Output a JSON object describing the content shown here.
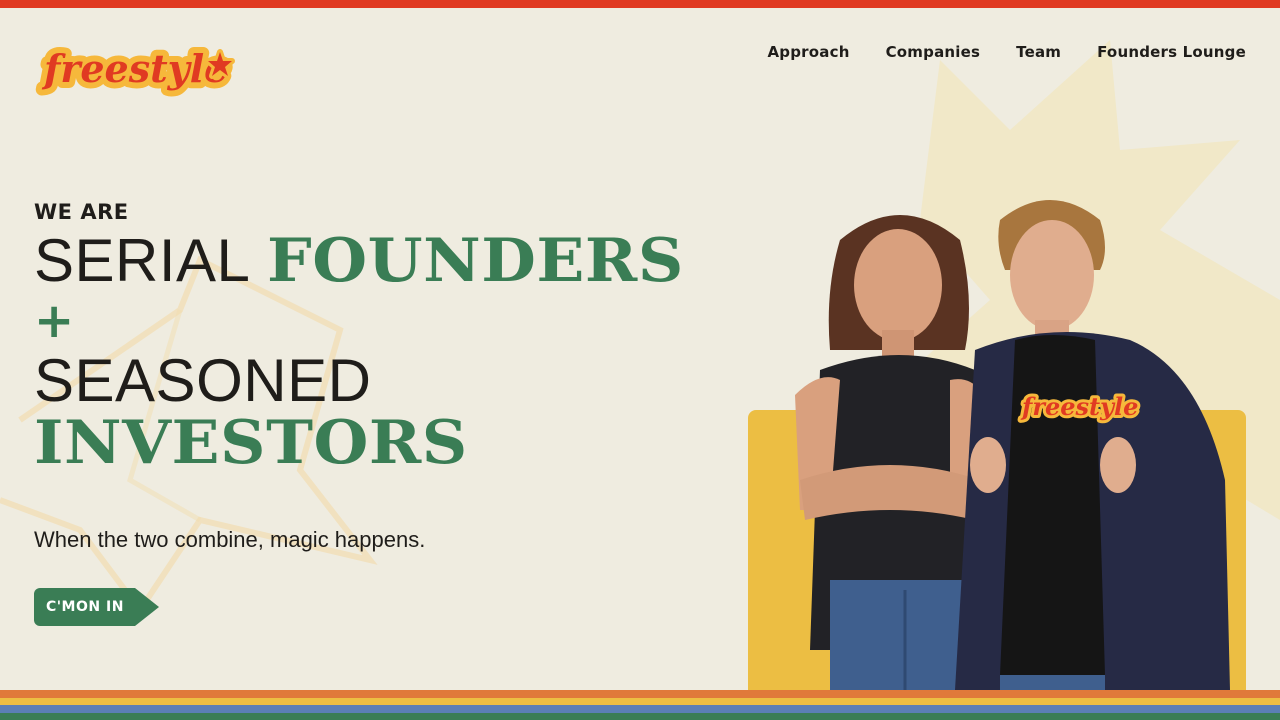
{
  "brand": {
    "logo_text": "freestyle",
    "logo_icon": "star-icon",
    "colors": {
      "accent_red": "#e03a22",
      "logo_yellow": "#f6b83b",
      "green": "#3a7d55",
      "card_yellow": "#ecbe43",
      "background": "#efece0",
      "text": "#1f1d1a"
    }
  },
  "nav": {
    "items": [
      {
        "label": "Approach"
      },
      {
        "label": "Companies"
      },
      {
        "label": "Team"
      },
      {
        "label": "Founders Lounge"
      }
    ]
  },
  "hero": {
    "eyebrow": "WE ARE",
    "line1_light": "SERIAL",
    "line1_heavy": "FOUNDERS",
    "plus": "+",
    "line2_light": "SEASONED",
    "line3_heavy": "INVESTORS",
    "tagline": "When the two combine, magic happens.",
    "cta_label": "C'MON IN"
  },
  "photo": {
    "shirt_text": "freestyle"
  },
  "footer_stripes": [
    "#e0793a",
    "#ecbe43",
    "#5b7fb5",
    "#3a7d55"
  ]
}
